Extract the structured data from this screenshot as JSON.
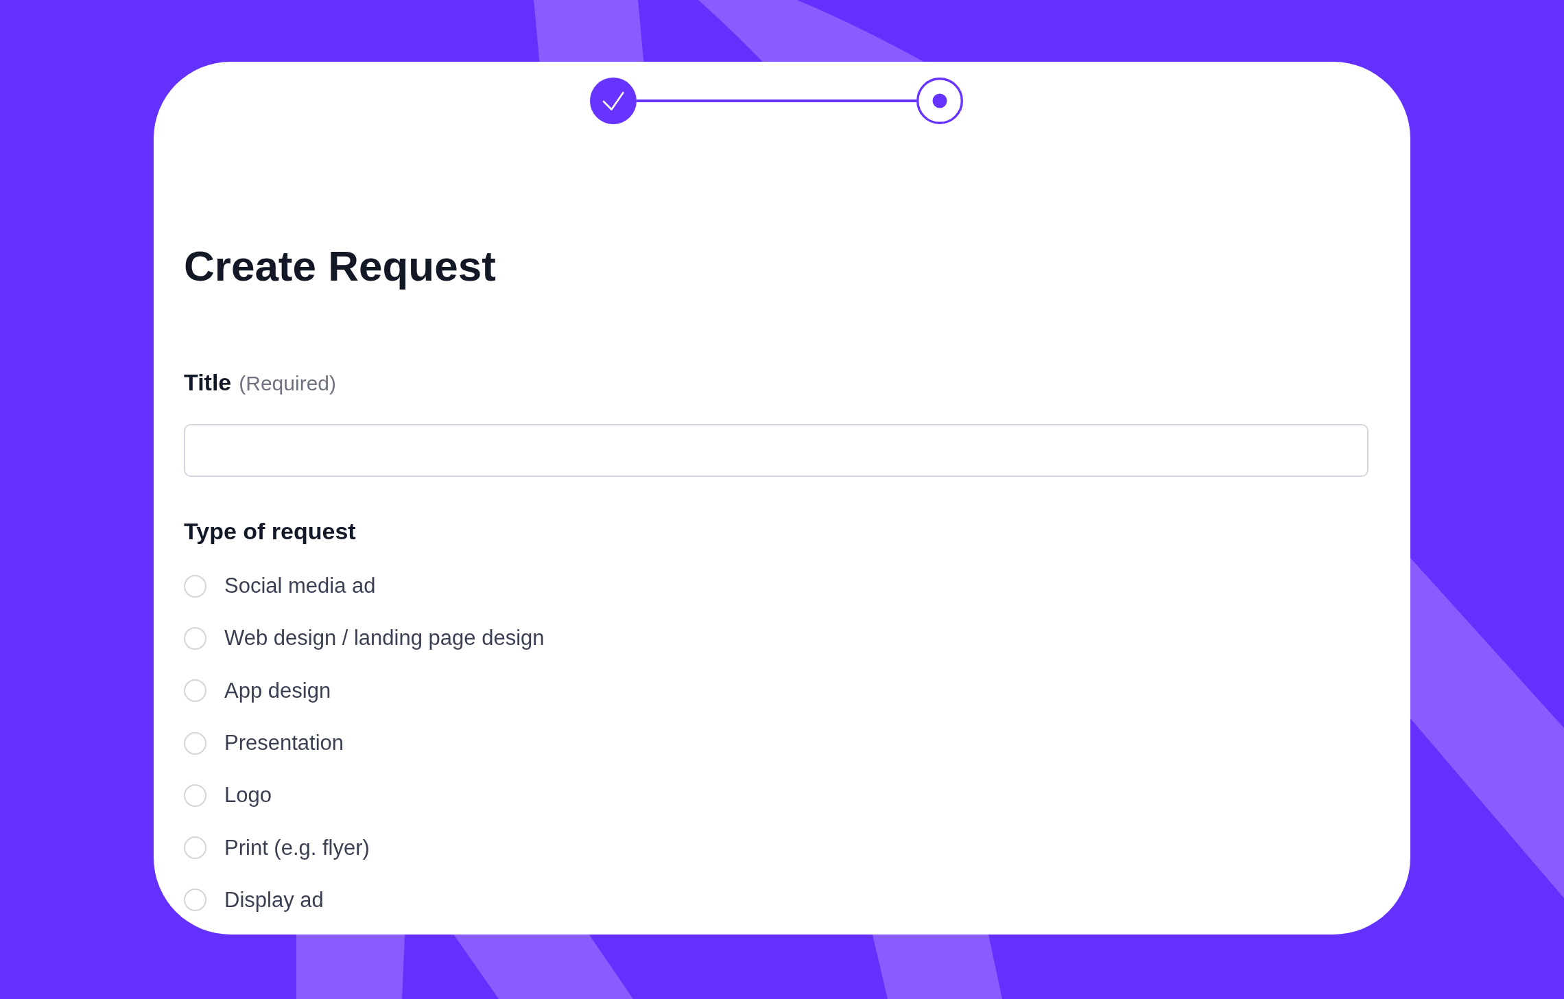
{
  "stepper": {
    "steps": [
      {
        "completed": true
      },
      {
        "completed": false
      }
    ]
  },
  "heading": "Create Request",
  "title_field": {
    "label": "Title",
    "note": "(Required)"
  },
  "request_type": {
    "label": "Type of request",
    "options": [
      {
        "label": "Social media ad",
        "selected": false
      },
      {
        "label": "Web design / landing page design",
        "selected": false
      },
      {
        "label": "App design",
        "selected": false
      },
      {
        "label": "Presentation",
        "selected": false
      },
      {
        "label": "Logo",
        "selected": false
      },
      {
        "label": "Print (e.g. flyer)",
        "selected": false
      },
      {
        "label": "Display ad",
        "selected": false
      }
    ]
  }
}
